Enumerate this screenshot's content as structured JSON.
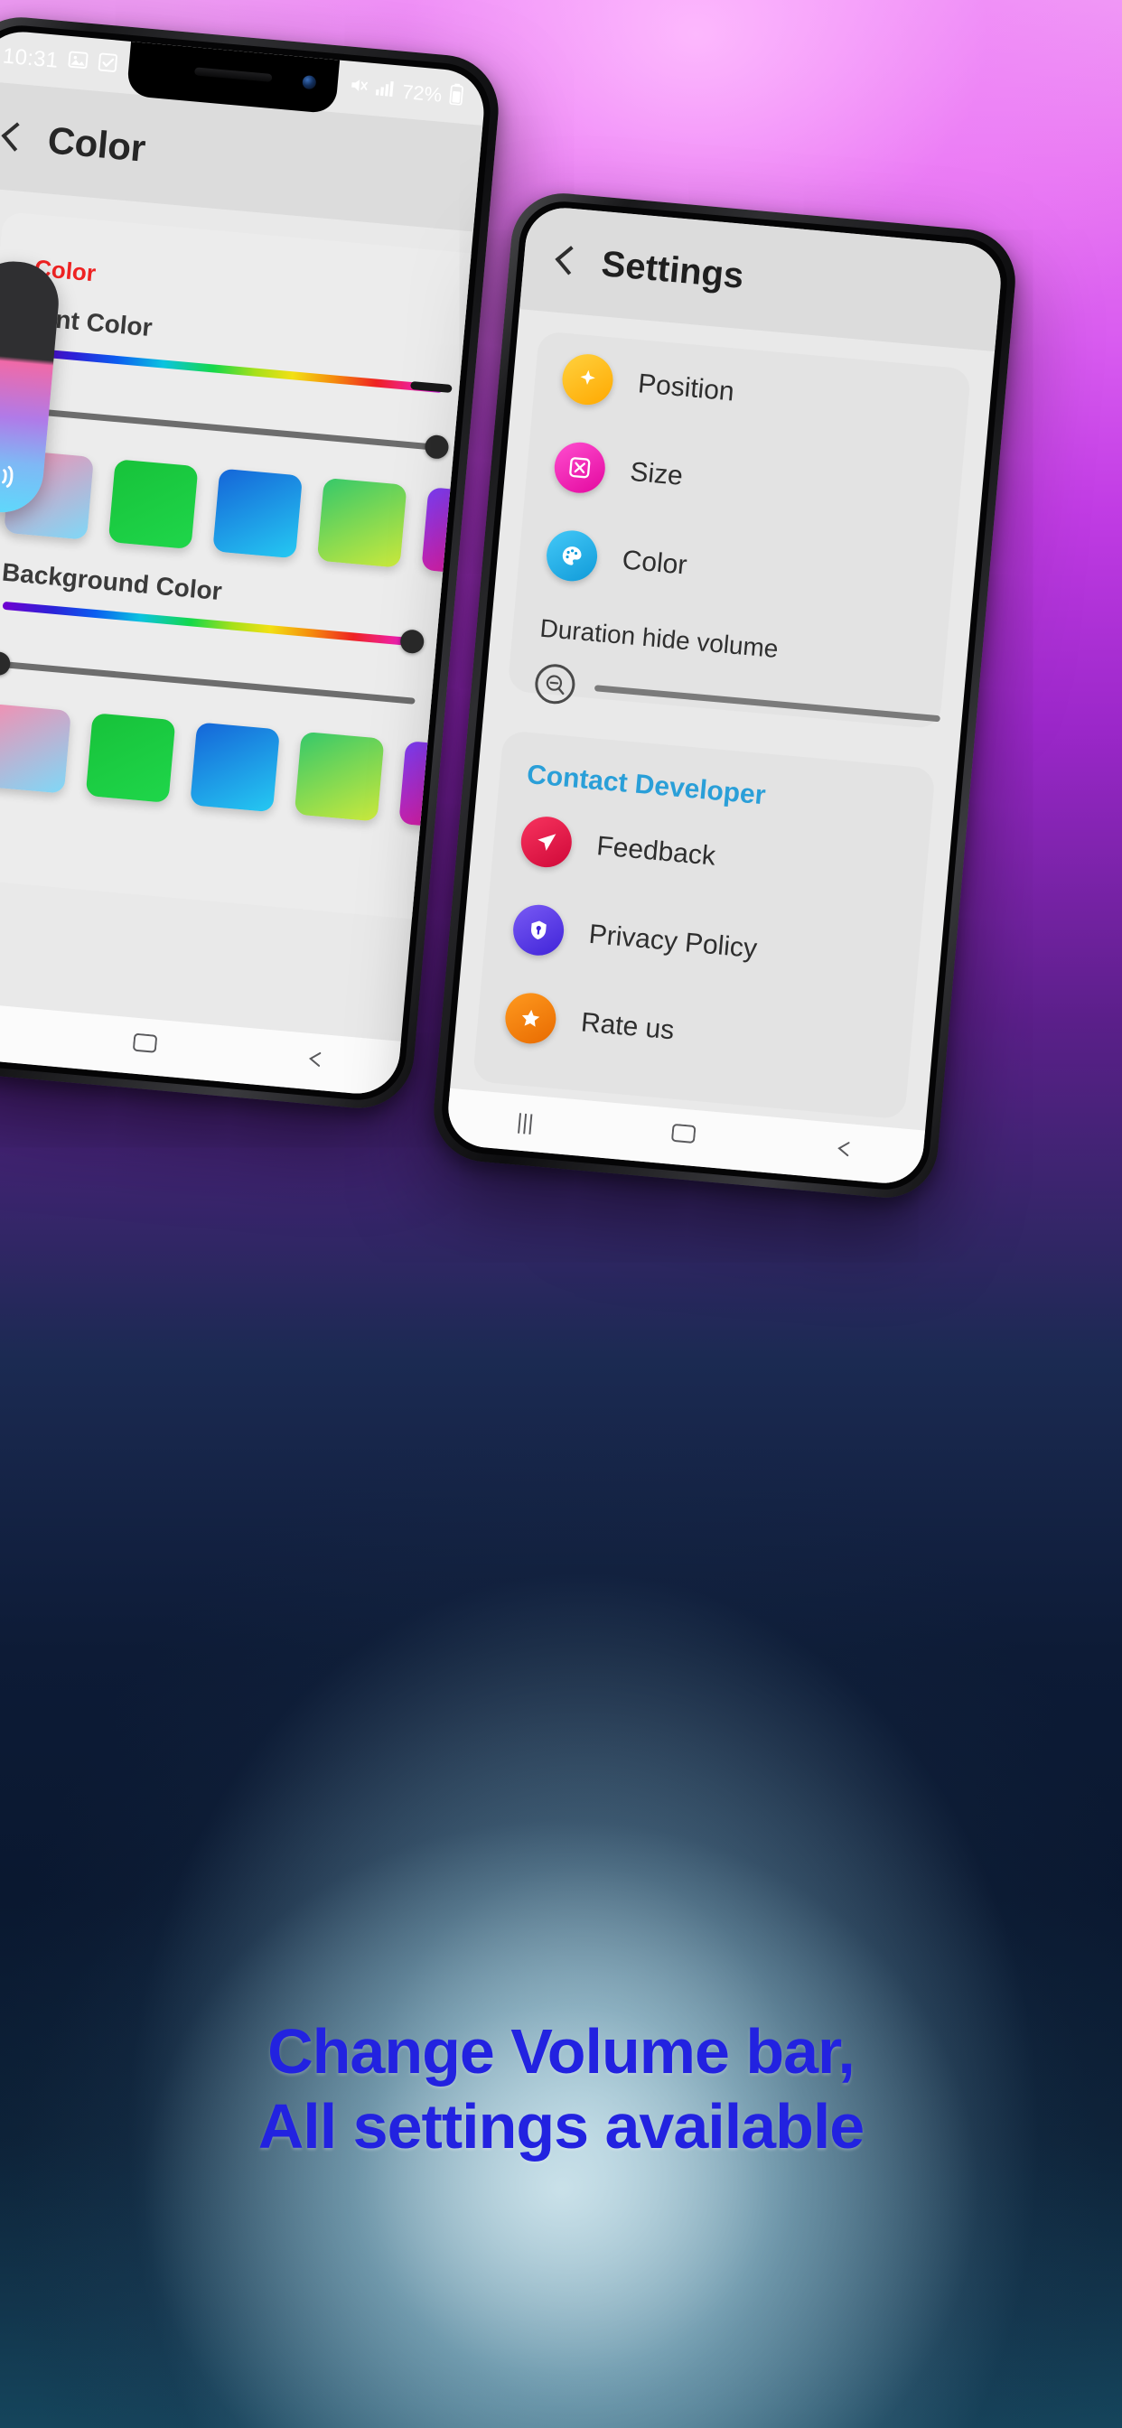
{
  "background": {
    "top_color": "#e878f2",
    "mid_color": "#5b1f8a",
    "bottom_color": "#0d1b36",
    "glow_color": "#cde4ec"
  },
  "caption": {
    "line1": "Change Volume bar,",
    "line2": "All settings available",
    "color": "#2222e0"
  },
  "left_phone": {
    "statusbar": {
      "time": "10:31",
      "icons_left": [
        "image-icon",
        "check-box-icon"
      ],
      "icons_right": [
        "silent-icon",
        "signal-icon"
      ],
      "battery": "72%",
      "battery_icon": "battery-icon"
    },
    "appbar": {
      "back_icon": "back-chevron-icon",
      "title": "Color"
    },
    "card": {
      "section_label": "Color",
      "section_label_color": "#ee2222",
      "font_color_label": "Font Color",
      "background_color_label": "Background Color",
      "font_hue_slider": {
        "name": "font-color-hue-slider",
        "value_pct": 86
      },
      "font_alpha_slider": {
        "name": "font-color-alpha-slider",
        "value_pct": 100
      },
      "background_hue_slider": {
        "name": "background-color-hue-slider",
        "value_pct": 96
      },
      "background_alpha_slider": {
        "name": "background-color-alpha-slider",
        "value_pct": 2
      },
      "font_swatches": [
        {
          "name": "swatch-pink-blue",
          "from": "#f48fb1",
          "to": "#7fd8f7"
        },
        {
          "name": "swatch-green",
          "from": "#17c23a",
          "to": "#1fd64a"
        },
        {
          "name": "swatch-blue",
          "from": "#1565d8",
          "to": "#25c9f2"
        },
        {
          "name": "swatch-green-yellow",
          "from": "#35c86a",
          "to": "#cbe93c"
        },
        {
          "name": "swatch-purple-pink",
          "from": "#7b3df5",
          "to": "#f5148c"
        }
      ],
      "background_swatches": [
        {
          "name": "swatch-pink-blue",
          "from": "#f48fb1",
          "to": "#7fd8f7"
        },
        {
          "name": "swatch-green",
          "from": "#17c23a",
          "to": "#1fd64a"
        },
        {
          "name": "swatch-blue",
          "from": "#1565d8",
          "to": "#25c9f2"
        },
        {
          "name": "swatch-green-yellow",
          "from": "#35c86a",
          "to": "#cbe93c"
        },
        {
          "name": "swatch-purple-pink",
          "from": "#7b3df5",
          "to": "#f5148c"
        }
      ]
    },
    "volume_overlay": {
      "name": "volume-bar-preview",
      "icon": "speaker-icon",
      "level_pct": 62
    },
    "navbar": [
      "recents-icon",
      "home-icon",
      "back-icon"
    ]
  },
  "right_phone": {
    "appbar": {
      "back_icon": "back-chevron-icon",
      "title": "Settings"
    },
    "settings_items": [
      {
        "label": "Position",
        "icon": "position-icon",
        "glyph": "✦",
        "color": "#ffc107"
      },
      {
        "label": "Size",
        "icon": "size-icon",
        "glyph": "⧉",
        "color": "#f324b0"
      },
      {
        "label": "Color",
        "icon": "color-palette-icon",
        "glyph": "◔",
        "color": "#2ab6f0"
      }
    ],
    "duration_label": "Duration hide volume",
    "duration_slider": {
      "name": "duration-slider",
      "icon": "timer-icon",
      "value_pct": 4
    },
    "contact_section_label": "Contact Developer",
    "contact_items": [
      {
        "label": "Feedback",
        "icon": "feedback-icon",
        "glyph": "✈",
        "color": "#e8194b"
      },
      {
        "label": "Privacy Policy",
        "icon": "shield-icon",
        "glyph": "⛊",
        "color": "#5b3df0"
      },
      {
        "label": "Rate us",
        "icon": "star-icon",
        "glyph": "★",
        "color": "#f07a10"
      }
    ],
    "navbar": [
      "recents-icon",
      "home-icon",
      "back-icon"
    ]
  }
}
